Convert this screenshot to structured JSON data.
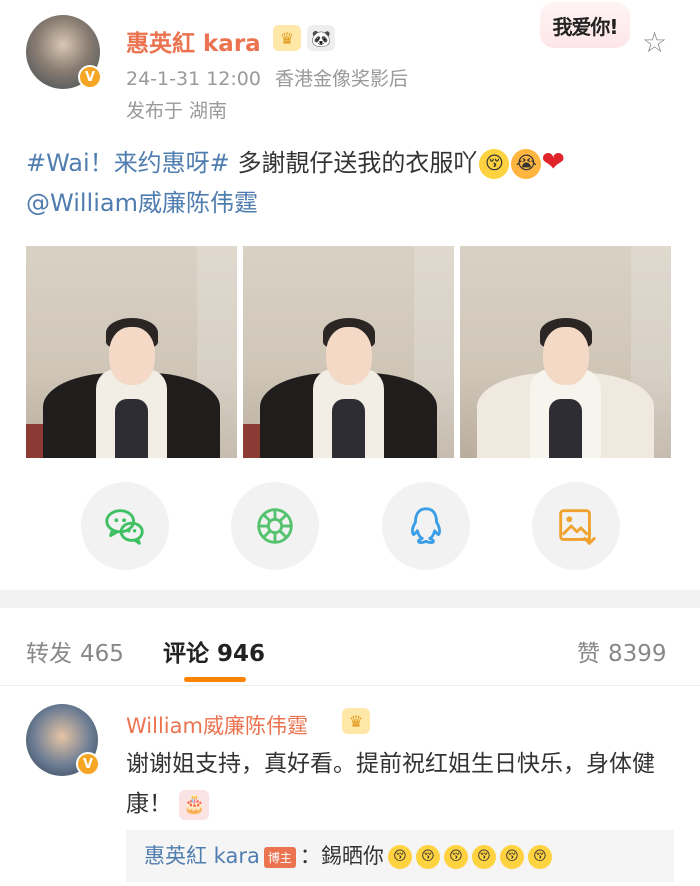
{
  "post": {
    "author": "惠英紅 kara",
    "date": "24-1-31 12:00",
    "title": "香港金像奖影后",
    "location": "发布于 湖南",
    "sticker": "我爱你!",
    "verified_mark": "V",
    "badge_crown": "♛",
    "badge_panda": "🐼",
    "star": "☆",
    "hashtag_1": "#Wai！",
    "hashtag_2": "来约惠呀#",
    "text": "多謝靚仔送我的衣服吖",
    "mention": "@William威廉陈伟霆",
    "emoji_1": "😚",
    "emoji_2": "😭",
    "heart": "❤"
  },
  "share_icons": [
    "wechat-icon",
    "moments-icon",
    "qq-icon",
    "save-image-icon"
  ],
  "tabs": {
    "repost_label": "转发",
    "repost_count": "465",
    "comment_label": "评论",
    "comment_count": "946",
    "like_label": "赞",
    "like_count": "8399"
  },
  "comment": {
    "author": "William威廉陈伟霆",
    "verified_mark": "V",
    "crown": "♛",
    "text": "谢谢姐支持，真好看。提前祝红姐生日快乐，身体健康！",
    "cake": "🎂",
    "reply_author": "惠英紅 kara",
    "reply_badge": "博主",
    "reply_text": "：錫晒你",
    "reply_emoji": "😚"
  },
  "colors": {
    "accent": "#eb7350",
    "link": "#507daf",
    "tab_indicator": "#ff8200",
    "wechat": "#3ec063",
    "moments": "#55c26d",
    "qq": "#3a9ee6",
    "save": "#f0a22e"
  }
}
